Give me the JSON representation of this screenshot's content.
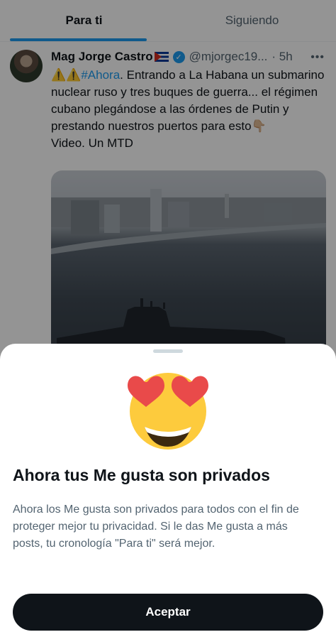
{
  "tabs": [
    {
      "label": "Para ti",
      "active": true
    },
    {
      "label": "Siguiendo",
      "active": false
    }
  ],
  "tweet": {
    "author_name": "Mag Jorge Castro",
    "handle": "@mjorgec19...",
    "time": "· 5h",
    "warning_emojis": "⚠️⚠️",
    "hashtag": "#Ahora",
    "text": ". Entrando a La Habana un submarino nuclear ruso y tres buques de guerra... el régimen cubano plegándose a las órdenes de Putin y prestando nuestros puertos para esto",
    "pointing_emoji": "👇🏼",
    "text_line2": "Video. Un MTD"
  },
  "sheet": {
    "title": "Ahora tus Me gusta son privados",
    "body": "Ahora los Me gusta son privados para todos con el fin de proteger mejor tu privacidad. Si le das Me gusta a más posts, tu cronología \"Para ti\" será mejor.",
    "accept_label": "Aceptar"
  },
  "colors": {
    "accent": "#1d9bf0",
    "text": "#0f1419",
    "secondary": "#536471",
    "button": "#0f1419"
  },
  "icons": [
    "cuba-flag-icon",
    "verified-badge-icon",
    "more-icon",
    "heart-eyes-emoji-icon"
  ]
}
